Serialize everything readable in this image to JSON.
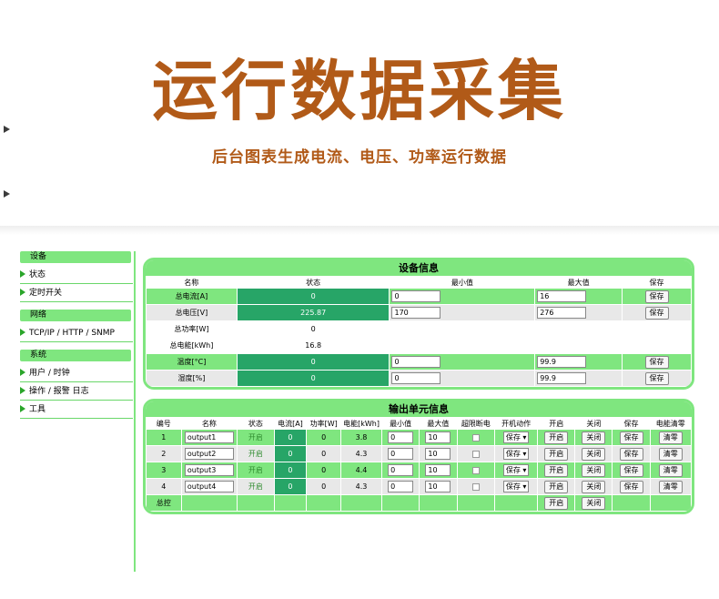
{
  "hero": {
    "title": "运行数据采集",
    "subtitle": "后台图表生成电流、电压、功率运行数据"
  },
  "sidebar": {
    "sections": [
      {
        "heading": "设备",
        "items": [
          "状态",
          "定时开关"
        ]
      },
      {
        "heading": "网络",
        "items": [
          "TCP/IP / HTTP / SNMP"
        ]
      },
      {
        "heading": "系统",
        "items": [
          "用户 / 时钟",
          "操作 / 报警 日志",
          "工具"
        ]
      }
    ]
  },
  "device": {
    "title": "设备信息",
    "headers": [
      "名称",
      "状态",
      "最小值",
      "最大值",
      "保存"
    ],
    "save_label": "保存",
    "rows": [
      {
        "name": "总电流[A]",
        "status": "0",
        "min": "0",
        "max": "16"
      },
      {
        "name": "总电压[V]",
        "status": "225.87",
        "min": "170",
        "max": "276"
      },
      {
        "name": "总功率[W]",
        "status": "0"
      },
      {
        "name": "总电能[kWh]",
        "status": "16.8"
      },
      {
        "name": "温度[°C]",
        "status": "0",
        "min": "0",
        "max": "99.9"
      },
      {
        "name": "湿度[%]",
        "status": "0",
        "min": "0",
        "max": "99.9"
      }
    ]
  },
  "output": {
    "title": "输出单元信息",
    "headers": [
      "编号",
      "名称",
      "状态",
      "电流[A]",
      "功率[W]",
      "电能[kWh]",
      "最小值",
      "最大值",
      "超限断电",
      "开机动作",
      "开启",
      "关闭",
      "保存",
      "电能清零"
    ],
    "rows": [
      {
        "id": "1",
        "name": "output1",
        "state": "开启",
        "current": "0",
        "power": "0",
        "energy": "3.8",
        "min": "0",
        "max": "10",
        "action": "保存"
      },
      {
        "id": "2",
        "name": "output2",
        "state": "开启",
        "current": "0",
        "power": "0",
        "energy": "4.3",
        "min": "0",
        "max": "10",
        "action": "保存"
      },
      {
        "id": "3",
        "name": "output3",
        "state": "开启",
        "current": "0",
        "power": "0",
        "energy": "4.4",
        "min": "0",
        "max": "10",
        "action": "保存"
      },
      {
        "id": "4",
        "name": "output4",
        "state": "开启",
        "current": "0",
        "power": "0",
        "energy": "4.3",
        "min": "0",
        "max": "10",
        "action": "保存"
      }
    ],
    "labels": {
      "on": "开启",
      "off": "关闭",
      "save": "保存",
      "clear": "清零"
    },
    "master": {
      "label": "总控",
      "on": "开启",
      "off": "关闭"
    }
  },
  "colors": {
    "accent_green": "#7fe67f",
    "dark_green": "#27a567",
    "hero_brown": "#b15a18"
  }
}
